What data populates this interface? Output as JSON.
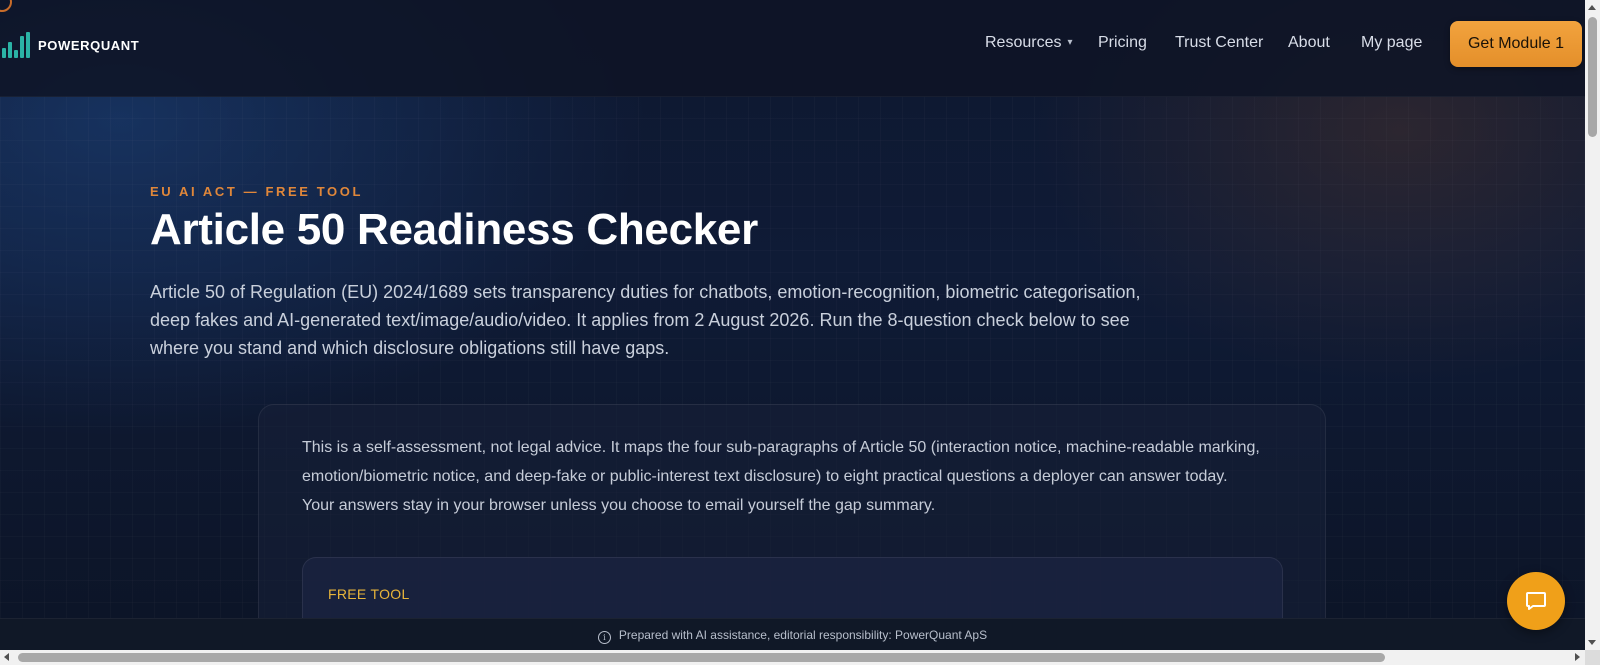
{
  "brand": {
    "name": "POWERQUANT",
    "accent_color": "#e0873a",
    "logo_color": "#2bb3a6"
  },
  "nav": {
    "items": [
      {
        "label": "Resources",
        "has_dropdown": true
      },
      {
        "label": "Pricing",
        "has_dropdown": false
      },
      {
        "label": "Trust Center",
        "has_dropdown": false
      },
      {
        "label": "About",
        "has_dropdown": false
      },
      {
        "label": "My page",
        "has_dropdown": false
      }
    ],
    "cta_label": "Get Module 1",
    "cta_color": "#f2a33e"
  },
  "hero": {
    "eyebrow": "EU AI ACT — FREE TOOL",
    "title": "Article 50 Readiness Checker",
    "lead": "Article 50 of Regulation (EU) 2024/1689 sets transparency duties for chatbots, emotion-recognition, biometric categorisation, deep fakes and AI-generated text/image/audio/video. It applies from 2 August 2026. Run the 8-question check below to see where you stand and which disclosure obligations still have gaps."
  },
  "card": {
    "intro": "This is a self-assessment, not legal advice. It maps the four sub-paragraphs of Article 50 (interaction notice, machine-readable marking, emotion/biometric notice, and deep-fake or public-interest text disclosure) to eight practical questions a deployer can answer today. Your answers stay in your browser unless you choose to email yourself the gap summary.",
    "badge": "FREE TOOL",
    "badge_color": "#e8b53a"
  },
  "footer": {
    "notice": "Prepared with AI assistance, editorial responsibility: PowerQuant ApS",
    "info_icon": "info-icon"
  },
  "chat": {
    "icon": "chat-bubble-icon",
    "color": "#f0a019"
  }
}
